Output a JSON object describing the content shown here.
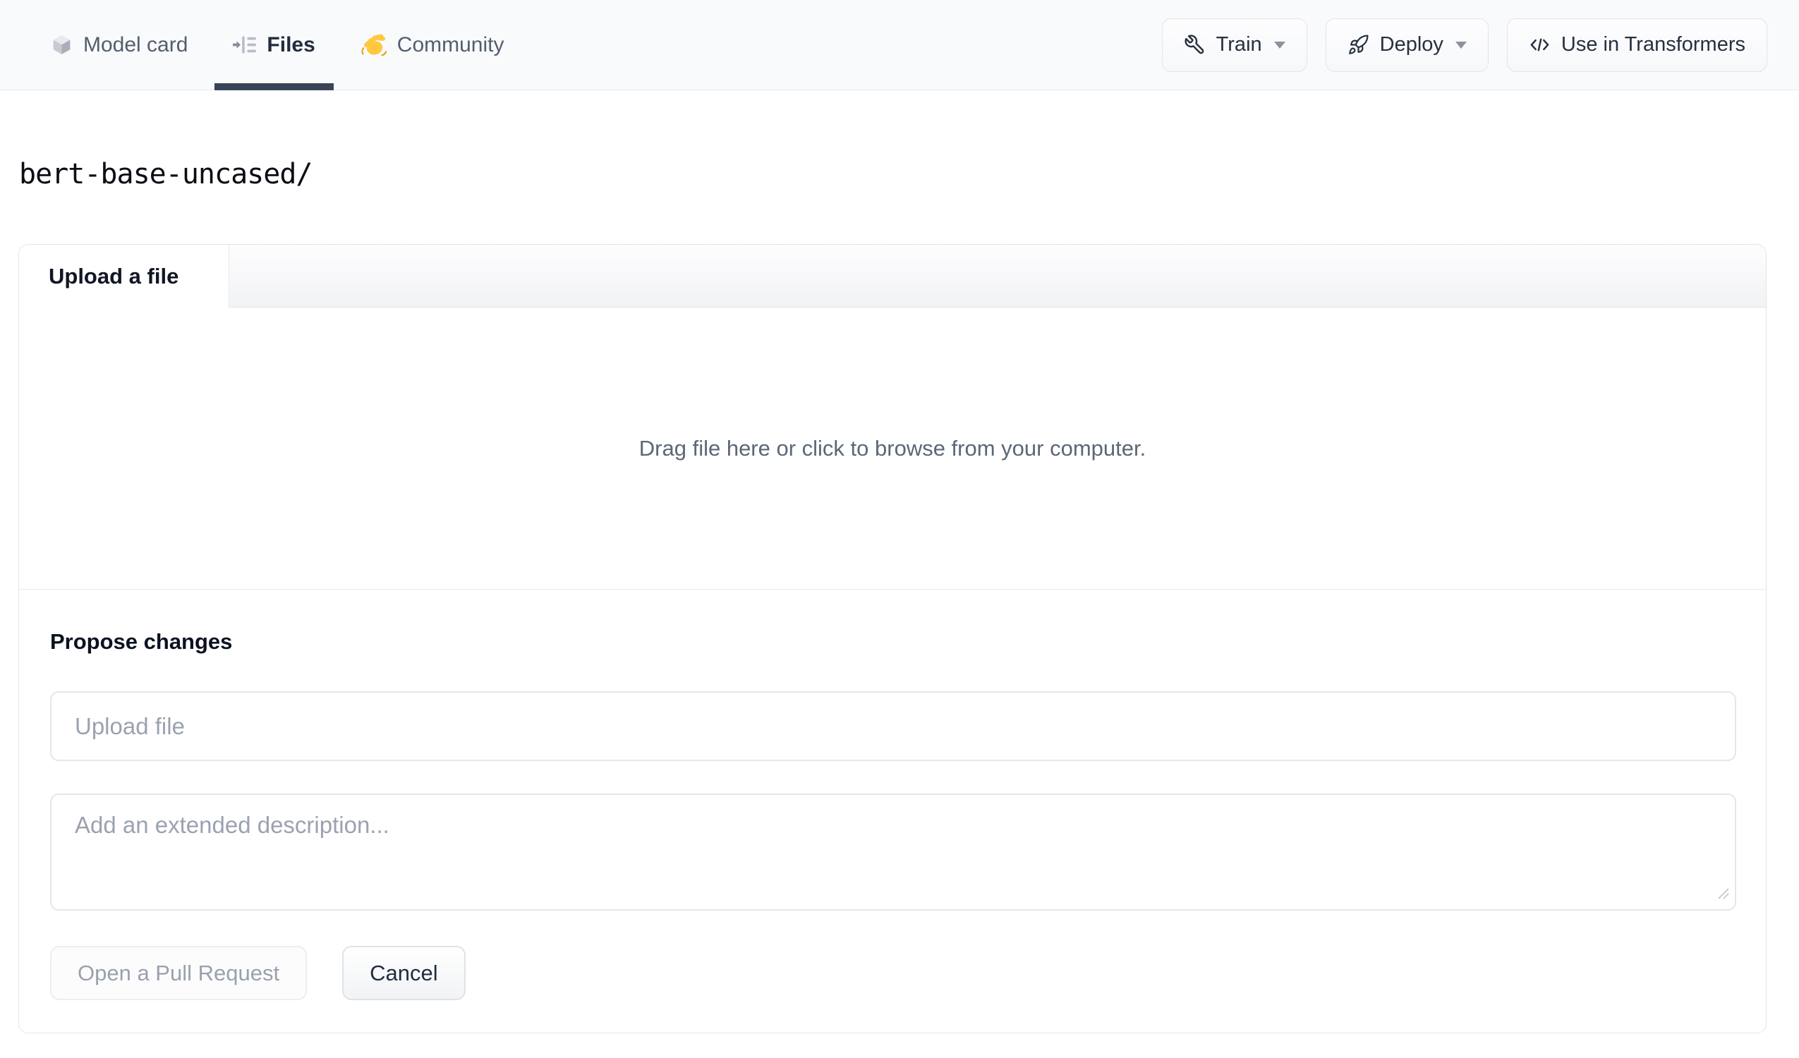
{
  "nav": {
    "tabs": [
      {
        "label": "Model card",
        "icon": "cube-icon",
        "active": false
      },
      {
        "label": "Files",
        "icon": "versions-icon",
        "active": true
      },
      {
        "label": "Community",
        "icon": "waving-hand-icon",
        "active": false
      }
    ],
    "actions": [
      {
        "label": "Train",
        "icon": "wrench-icon",
        "has_dropdown": true
      },
      {
        "label": "Deploy",
        "icon": "rocket-icon",
        "has_dropdown": true
      },
      {
        "label": "Use in Transformers",
        "icon": "code-icon",
        "has_dropdown": false
      }
    ]
  },
  "breadcrumb": {
    "path": "bert-base-uncased/"
  },
  "upload_card": {
    "tab_label": "Upload a file",
    "dropzone_text": "Drag file here or click to browse from your computer.",
    "propose": {
      "heading": "Propose changes",
      "filename_placeholder": "Upload file",
      "description_placeholder": "Add an extended description...",
      "submit_label": "Open a Pull Request",
      "cancel_label": "Cancel"
    }
  },
  "colors": {
    "nav_background": "#f8fafc",
    "active_tab_underline": "#3a4457",
    "active_tab_text": "#222c3d",
    "inactive_tab_text": "#535e6d",
    "card_border": "#e2e5e9",
    "placeholder_text": "#9aa2b1",
    "dropzone_text": "#5c6776",
    "disabled_button_text": "#9aa1ad",
    "hand_emoji_yellow": "#ffc83d"
  }
}
